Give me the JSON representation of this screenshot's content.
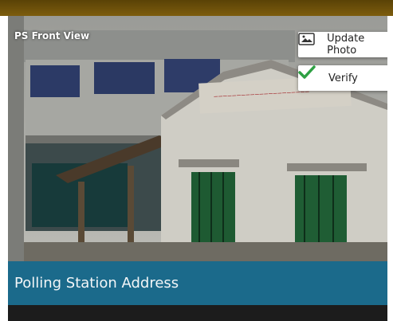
{
  "photo": {
    "label": "PS Front View",
    "actions": {
      "update_photo_label": "Update Photo",
      "verify_label": "Verify"
    },
    "carousel": {
      "slides": 2,
      "active_index": 0
    }
  },
  "address_bar": {
    "title": "Polling Station Address"
  },
  "colors": {
    "accent": "#1b6a8b",
    "verify_check": "#2ea043"
  }
}
